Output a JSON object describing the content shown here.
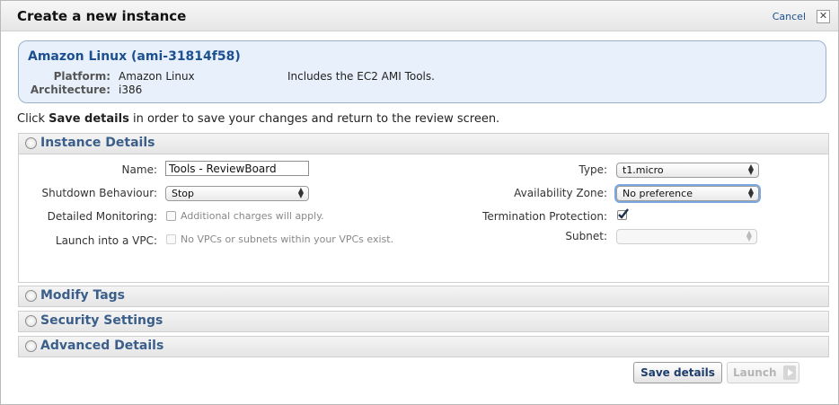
{
  "dialog": {
    "title": "Create a new instance",
    "cancel_label": "Cancel",
    "close_glyph": "✕"
  },
  "ami": {
    "name": "Amazon Linux (ami-31814f58)",
    "platform_label": "Platform:",
    "platform_value": "Amazon Linux",
    "architecture_label": "Architecture:",
    "architecture_value": "i386",
    "description": "Includes the EC2 AMI Tools."
  },
  "hint": {
    "prefix": "Click ",
    "bold": "Save details",
    "suffix": " in order to save your changes and return to the review screen."
  },
  "sections": {
    "instance_details": "Instance Details",
    "modify_tags": "Modify Tags",
    "security_settings": "Security Settings",
    "advanced_details": "Advanced Details"
  },
  "form": {
    "name_label": "Name:",
    "name_value": "Tools - ReviewBoard",
    "shutdown_label": "Shutdown Behaviour:",
    "shutdown_value": "Stop",
    "monitoring_label": "Detailed Monitoring:",
    "monitoring_note": "Additional charges will apply.",
    "vpc_label": "Launch into a VPC:",
    "vpc_note": "No VPCs or subnets within your VPCs exist.",
    "type_label": "Type:",
    "type_value": "t1.micro",
    "zone_label": "Availability Zone:",
    "zone_value": "No preference",
    "termination_label": "Termination Protection:",
    "termination_checked": true,
    "subnet_label": "Subnet:",
    "subnet_value": ""
  },
  "buttons": {
    "save": "Save details",
    "launch": "Launch"
  },
  "colors": {
    "accent": "#1d4f91",
    "section_text": "#3b5f8a",
    "ami_bg": "#e8f1fb"
  }
}
